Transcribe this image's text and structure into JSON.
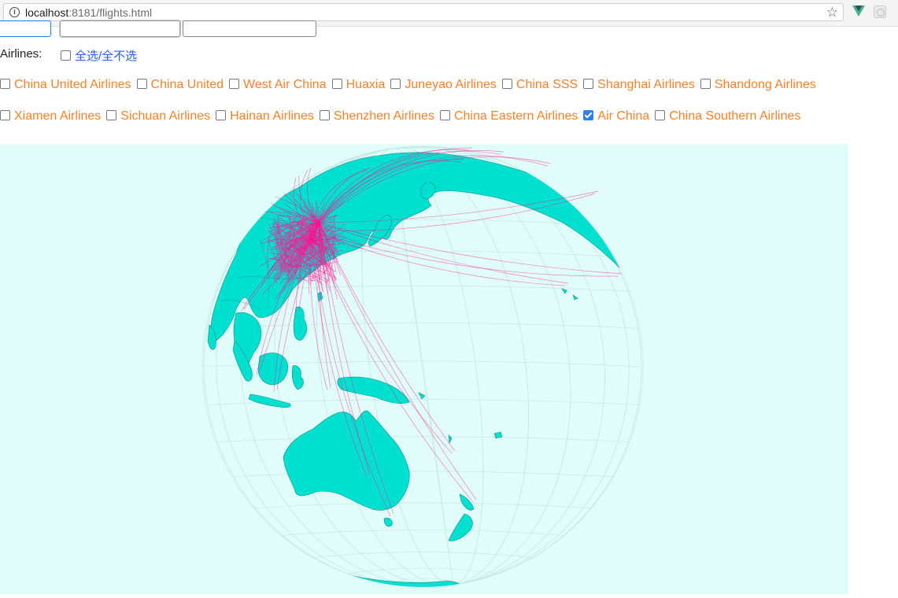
{
  "browser": {
    "url_host": "localhost",
    "url_rest": ":8181/flights.html"
  },
  "filters": {
    "airlines_label": "Airlines:",
    "select_all_label": "全选/全不选",
    "select_all_checked": false,
    "airlines": [
      {
        "name": "China United Airlines",
        "checked": false
      },
      {
        "name": "China United",
        "checked": false
      },
      {
        "name": "West Air China",
        "checked": false
      },
      {
        "name": "Huaxia",
        "checked": false
      },
      {
        "name": "Juneyao Airlines",
        "checked": false
      },
      {
        "name": "China SSS",
        "checked": false
      },
      {
        "name": "Shanghai Airlines",
        "checked": false
      },
      {
        "name": "Shandong Airlines",
        "checked": false
      },
      {
        "name": "Xiamen Airlines",
        "checked": false
      },
      {
        "name": "Sichuan Airlines",
        "checked": false
      },
      {
        "name": "Hainan Airlines",
        "checked": false
      },
      {
        "name": "Shenzhen Airlines",
        "checked": false
      },
      {
        "name": "China Eastern Airlines",
        "checked": false
      },
      {
        "name": "Air China",
        "checked": true
      },
      {
        "name": "China Southern Airlines",
        "checked": false
      }
    ]
  },
  "map": {
    "projection": "orthographic globe",
    "background_color": "#e0fdf9",
    "land_color": "#00e0d0",
    "route_color": "#ff1493"
  }
}
